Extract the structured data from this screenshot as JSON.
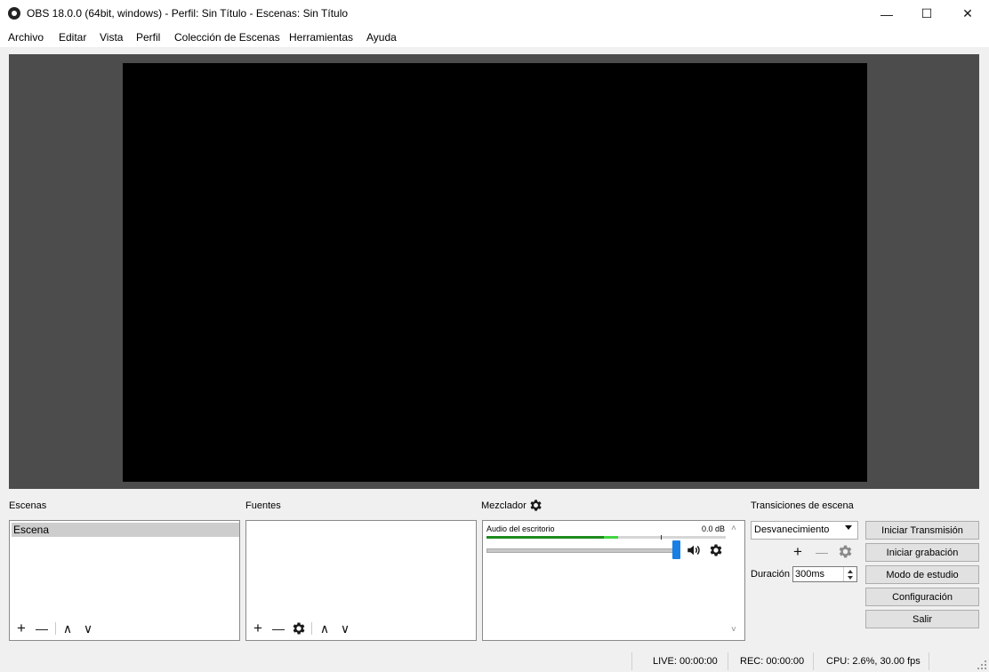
{
  "window": {
    "title": "OBS 18.0.0 (64bit, windows) - Perfil: Sin Título - Escenas: Sin Título",
    "minimize_glyph": "—",
    "maximize_glyph": "☐",
    "close_glyph": "✕"
  },
  "menu": [
    "Archivo",
    "Editar",
    "Vista",
    "Perfil",
    "Colección de Escenas",
    "Herramientas",
    "Ayuda"
  ],
  "scenes": {
    "title": "Escenas",
    "items": [
      "Escena"
    ]
  },
  "sources": {
    "title": "Fuentes",
    "items": []
  },
  "mixer": {
    "title": "Mezclador",
    "tracks": [
      {
        "name": "Audio del escritorio",
        "level": "0.0 dB",
        "meter_fraction": 0.55,
        "volume_fraction": 1.0
      }
    ]
  },
  "transitions": {
    "title": "Transiciones de escena",
    "selected": "Desvanecimiento",
    "duration_label": "Duración",
    "duration_value": "300ms"
  },
  "controls": {
    "start_streaming": "Iniciar Transmisión",
    "start_recording": "Iniciar grabación",
    "studio_mode": "Modo de estudio",
    "settings": "Configuración",
    "exit": "Salir"
  },
  "status": {
    "live": "LIVE: 00:00:00",
    "rec": "REC: 00:00:00",
    "cpu": "CPU: 2.6%, 30.00 fps"
  },
  "icons": {
    "add": "+",
    "remove": "—",
    "up": "∧",
    "down": "∨",
    "scroll_up": "˄",
    "scroll_down": "˅"
  },
  "colors": {
    "preview_bg": "#4c4c4c",
    "canvas": "#000000",
    "meter_green": "#1e8c1e",
    "meter_light_green": "#41d641",
    "volume_handle": "#1880e4"
  }
}
